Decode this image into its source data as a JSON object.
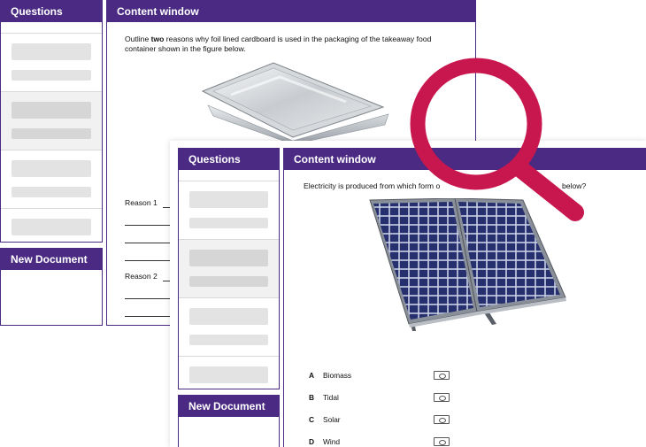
{
  "back": {
    "questions_title": "Questions",
    "content_title": "Content window",
    "new_document_title": "New Document",
    "question_prefix": "Outline ",
    "question_bold": "two",
    "question_rest": " reasons why foil lined cardboard is used in the packaging of the takeaway food container shown in the figure below.",
    "reason1_label": "Reason 1",
    "reason2_label": "Reason 2"
  },
  "front": {
    "questions_title": "Questions",
    "content_title": "Content window",
    "new_document_title": "New Document",
    "question_text_start": "Electricity is produced from which form o",
    "question_text_end": "below?",
    "options": [
      {
        "letter": "A",
        "text": "Biomass"
      },
      {
        "letter": "B",
        "text": "Tidal"
      },
      {
        "letter": "C",
        "text": "Solar"
      },
      {
        "letter": "D",
        "text": "Wind"
      }
    ]
  },
  "colors": {
    "brand_purple": "#4a2a82",
    "magnifier": "#c8174f"
  },
  "icons": {
    "magnifier": "magnifying-glass-icon",
    "foil_container": "foil-container-image",
    "solar_panel": "solar-panel-image"
  }
}
